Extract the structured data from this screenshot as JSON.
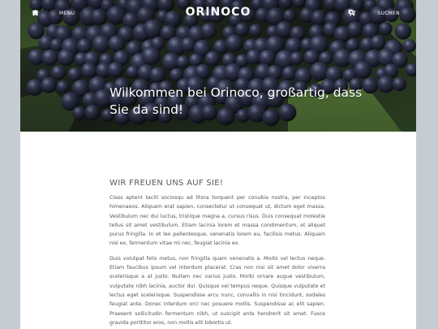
{
  "header": {
    "menu_label": "Menu",
    "logo": "ORINOCO",
    "search_label": "Suchen"
  },
  "icons": {
    "home": "home-icon",
    "menu": "hamburger-menu-icon",
    "cart": "cart-icon",
    "search": "search-icon"
  },
  "hero": {
    "title": "Wilkommen bei Orinoco, großartig, dass Sie da sind!"
  },
  "main": {
    "heading": "WIR FREUEN UNS AUF SIE!",
    "paragraphs": [
      "Class aptent taciti sociosqu ad litora torquent per conubia nostra, per inceptos himenaeos. Aliquam erat sapien, consectetur ut consequat ut, dictum eget massa. Vestibulum nec dui luctus, tristique magna a, cursus risus. Duis consequat molestie tellus sit amet vestibulum. Etiam lacinia lorem et massa condimentum, et aliquet purus fringilla. In et leo pellentesque, venenatis lorem eu, facilisis metus. Aliquam nisi ex, fermentum vitae mi nec, feugiat lacinia ex.",
      "Duis volutpat felis metus, non fringilla quam venenatis a. Morbi vel lectus neque. Etiam faucibus ipsum vel interdum placerat. Cras non nisi sit amet dolor viverra scelerisque a at justo. Nullam nec varius justo. Morbi ornare augue vestibulum, vulputate nibh lacinia, auctor dui. Quisque vel tempus neque. Quisque vulputate et lectus eget scelerisque. Suspendisse arcu nunc, convallis in nisi tincidunt, sodales feugiat ante. Donec interdum orci nec posuere mollis. Suspendisse ac elit sapien. Praesent sollicitudin fermentum nibh, ut suscipit ante hendrerit sit amet. Fusce gravida porttitor eros, non mollis elit lobortis ut."
    ]
  }
}
